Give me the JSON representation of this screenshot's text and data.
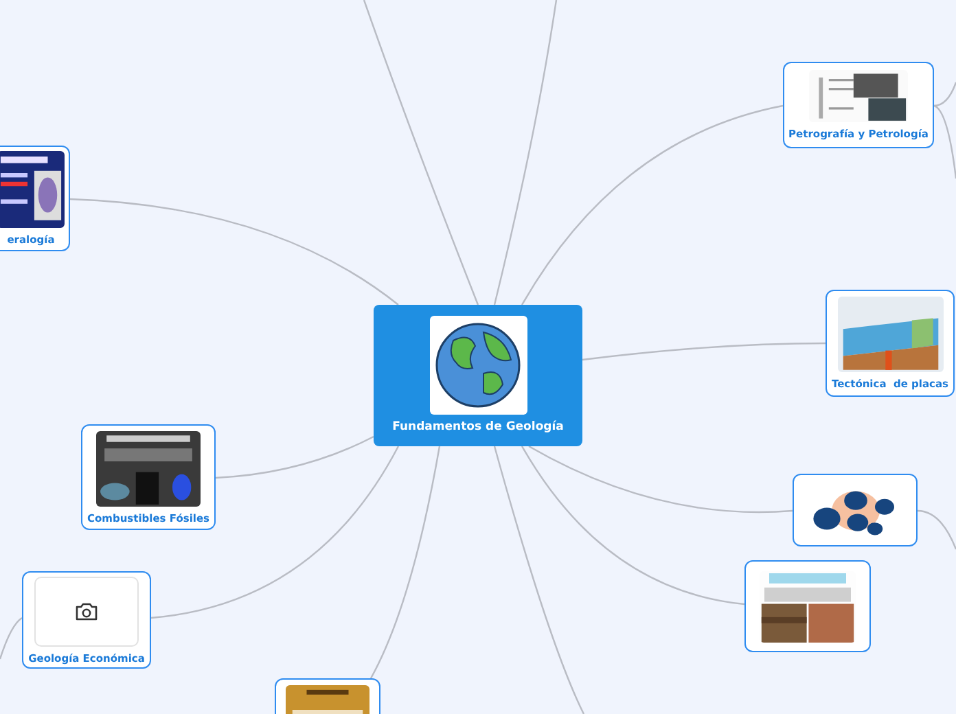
{
  "root": {
    "label": "Fundamentos de Geología"
  },
  "topics": [
    {
      "kind": "picture",
      "label": "eralogía"
    },
    {
      "kind": "picture",
      "label": "Petrografía y Petrología"
    },
    {
      "kind": "picture",
      "label": "Tectónica  de placas"
    },
    {
      "kind": "picture"
    },
    {
      "kind": "picture"
    },
    {
      "kind": "picture",
      "label": "Combustibles Fósiles"
    },
    {
      "kind": "placeholder",
      "label": "Geología Económica"
    },
    {
      "kind": "picture"
    }
  ]
}
